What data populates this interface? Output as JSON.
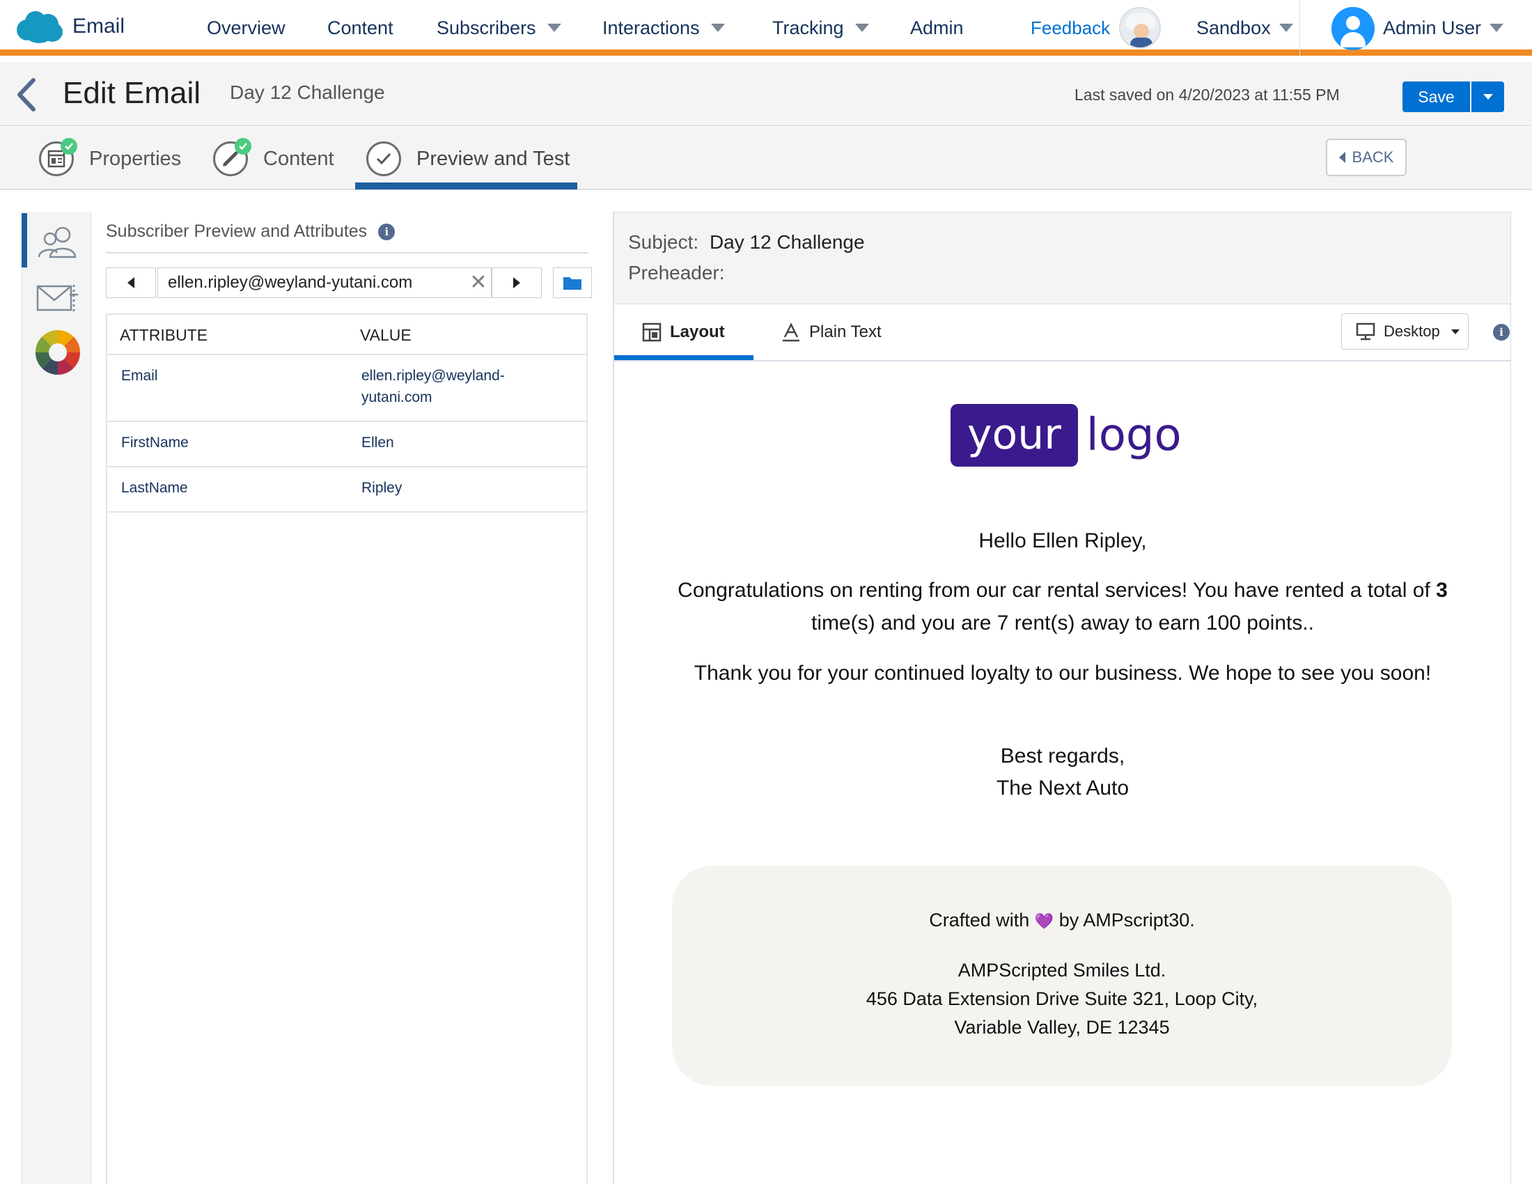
{
  "topnav": {
    "brand_label": "Email",
    "items": [
      "Overview",
      "Content",
      "Subscribers",
      "Interactions",
      "Tracking",
      "Admin"
    ],
    "feedback": "Feedback",
    "business_unit": "Sandbox",
    "user": "Admin User",
    "accent_color": "#f08a24"
  },
  "header": {
    "title": "Edit Email",
    "email_name": "Day 12 Challenge",
    "last_saved": "Last saved on 4/20/2023 at 11:55 PM",
    "save_label": "Save"
  },
  "steps": {
    "items": [
      "Properties",
      "Content",
      "Preview and Test"
    ],
    "active": "Preview and Test",
    "back_label": "BACK"
  },
  "sidebar": {
    "icons": [
      "subscribers-icon",
      "email-test-icon",
      "color-wheel-icon"
    ]
  },
  "subscriber_panel": {
    "heading": "Subscriber Preview and Attributes",
    "selected_subscriber": "ellen.ripley@weyland-yutani.com",
    "columns": [
      "ATTRIBUTE",
      "VALUE"
    ],
    "rows": [
      {
        "attribute": "Email",
        "value": "ellen.ripley@weyland-yutani.com"
      },
      {
        "attribute": "FirstName",
        "value": "Ellen"
      },
      {
        "attribute": "LastName",
        "value": "Ripley"
      }
    ]
  },
  "preview": {
    "subject_label": "Subject:",
    "subject": "Day 12 Challenge",
    "preheader_label": "Preheader:",
    "preheader": "",
    "tabs": [
      "Layout",
      "Plain Text"
    ],
    "active_tab": "Layout",
    "device": "Desktop"
  },
  "email": {
    "logo_box": "your",
    "logo_text": "logo",
    "greeting": "Hello Ellen Ripley,",
    "para1_a": "Congratulations on renting from our car rental services! You have rented a total of ",
    "para1_count": "3",
    "para1_b": " time(s) and you are 7 rent(s) away to earn 100 points..",
    "para2": "Thank you for your continued loyalty to our business. We hope to see you soon!",
    "signoff": "Best regards,",
    "signature": "The Next Auto",
    "footer_crafted_a": "Crafted with ",
    "footer_crafted_heart": "💜",
    "footer_crafted_b": " by AMPscript30.",
    "footer_company": "AMPScripted Smiles Ltd.",
    "footer_address1": "456 Data Extension Drive Suite 321, Loop City,",
    "footer_address2": "Variable Valley, DE 12345",
    "logo_color": "#3a1a8c"
  }
}
